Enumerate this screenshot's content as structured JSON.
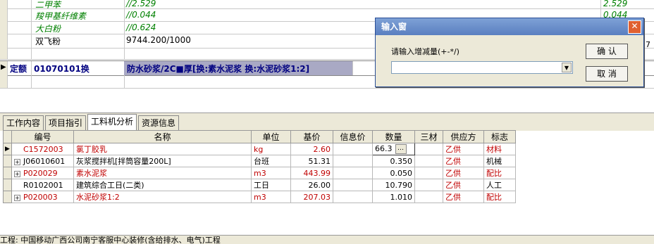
{
  "top_rows": [
    {
      "name": "二甲苯",
      "value": "//2.529",
      "right": "2.529"
    },
    {
      "name": "羧甲基纤维素",
      "value": "//0.044",
      "right": "0.044"
    },
    {
      "name": "大白粉",
      "value": "//0.624",
      "right": ""
    },
    {
      "name": "双飞粉",
      "value": "9744.200/1000",
      "right": ""
    }
  ],
  "quota_row": {
    "label": "定额",
    "code": "01070101换",
    "desc": "防水砂浆/2C■厚[换:素水泥浆 换:水泥砂浆1:2]",
    "marker": "▶"
  },
  "tabs": [
    "工作内容",
    "项目指引",
    "工料机分析",
    "资源信息"
  ],
  "table": {
    "headers": [
      "编号",
      "名称",
      "单位",
      "基价",
      "信息价",
      "数量",
      "三材",
      "供应方",
      "标志"
    ],
    "rows": [
      {
        "code": "C1572003",
        "name": "氯丁胶乳",
        "unit": "kg",
        "price": "2.60",
        "info": "",
        "qty": "66.3",
        "sancai": "",
        "supplier": "乙供",
        "flag": "材料",
        "red": true,
        "expand": false,
        "editing": true
      },
      {
        "code": "J06010601",
        "name": "灰浆搅拌机[拌筒容量200L]",
        "unit": "台班",
        "price": "51.31",
        "info": "",
        "qty": "0.350",
        "sancai": "",
        "supplier": "乙供",
        "flag": "机械",
        "red": false,
        "expand": true,
        "editing": false
      },
      {
        "code": "P020029",
        "name": "素水泥浆",
        "unit": "m3",
        "price": "443.99",
        "info": "",
        "qty": "0.050",
        "sancai": "",
        "supplier": "乙供",
        "flag": "配比",
        "red": true,
        "expand": true,
        "editing": false
      },
      {
        "code": "R0102001",
        "name": "建筑综合工日(二类)",
        "unit": "工日",
        "price": "26.00",
        "info": "",
        "qty": "10.790",
        "sancai": "",
        "supplier": "乙供",
        "flag": "人工",
        "red": false,
        "expand": false,
        "editing": false
      },
      {
        "code": "P020003",
        "name": "水泥砂浆1:2",
        "unit": "m3",
        "price": "207.03",
        "info": "",
        "qty": "1.010",
        "sancai": "",
        "supplier": "乙供",
        "flag": "配比",
        "red": true,
        "expand": true,
        "editing": false
      }
    ]
  },
  "status_text": "工程: 中国移动广西公司南宁客服中心装修(含给排水、电气)工程",
  "dialog": {
    "title": "输入窗",
    "prompt": "请输入增减量(+-*/)",
    "input_value": "",
    "ok_label": "确 认",
    "cancel_label": "取 消",
    "close_glyph": "✕"
  },
  "edge_text": "7"
}
